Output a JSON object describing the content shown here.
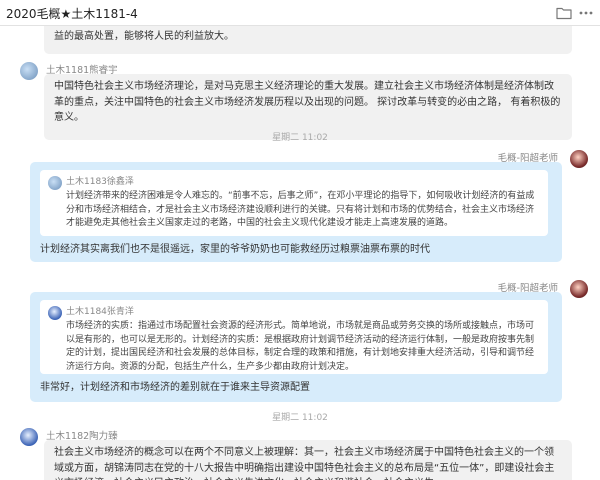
{
  "window": {
    "title": "2020毛概★土木1181-4"
  },
  "icons": {
    "folder": "folder-icon",
    "more": "more-icon"
  },
  "messages": [
    {
      "id": "m0",
      "text": "实现资源配置的最大化，同中国特色社会主义市场经济也是紧密结合的，既有优点，又有调控性能最大化，实现利益的最高处置，能够将人民的利益放大。"
    },
    {
      "id": "m1",
      "sender": "土木1181熊睿宇",
      "text": "中国特色社会主义市场经济理论，是对马克思主义经济理论的重大发展。建立社会主义市场经济体制是经济体制改革的重点，关注中国特色的社会主义市场经济发展历程以及出现的问题。 探讨改革与转变的必由之路， 有着积极的意义。"
    },
    {
      "id": "t1",
      "time": "星期二 11:02"
    },
    {
      "id": "m2",
      "sender": "毛概-阳超老师",
      "quote_name": "土木1183徐鑫泽",
      "quote_text": "计划经济带来的经济困难是令人难忘的。“前事不忘，后事之师”，在邓小平理论的指导下，如何吸收计划经济的有益成分和市场经济相结合，才是社会主义市场经济建设顺利进行的关键。只有将计划和市场的优势结合，社会主义市场经济才能避免走其他社会主义国家走过的老路，中国的社会主义现代化建设才能走上高速发展的道路。",
      "reply": "计划经济其实离我们也不是很遥远，家里的爷爷奶奶也可能救经历过粮票油票布票的时代"
    },
    {
      "id": "m3",
      "sender": "毛概-阳超老师",
      "quote_name": "土木1184张青洋",
      "quote_text": "市场经济的实质：指通过市场配置社会资源的经济形式。简单地说，市场就是商品或劳务交换的场所或接触点，市场可以是有形的，也可以是无形的。计划经济的实质：是根据政府计划调节经济活动的经济运行体制，一般是政府按事先制定的计划，提出国民经济和社会发展的总体目标，制定合理的政策和措施，有计划地安排重大经济活动，引导和调节经济运行方向。资源的分配，包括生产什么，生产多少都由政府计划决定。",
      "reply": "非常好，计划经济和市场经济的差别就在于谁来主导资源配置"
    },
    {
      "id": "t2",
      "time": "星期二 11:02"
    },
    {
      "id": "m4",
      "sender": "土木1182陶力臻",
      "text": "社会主义市场经济的概念可以在两个不同意义上被理解：其一，社会主义市场经济属于中国特色社会主义的一个领域或方面，胡锦涛同志在党的十八大报告中明确指出建设中国特色社会主义的总布局是“五位一体”，即建设社会主义市场经济、社会主义民主政治、社会主义先进文化、社会主义和谐社会、社会主义生"
    }
  ],
  "colors": {
    "own_bubble": "#d7ecfb",
    "other_bubble": "#f1f1f1",
    "quote_background": "#ffffff",
    "meta_text": "#888888",
    "time_text": "#a9a9a9"
  }
}
